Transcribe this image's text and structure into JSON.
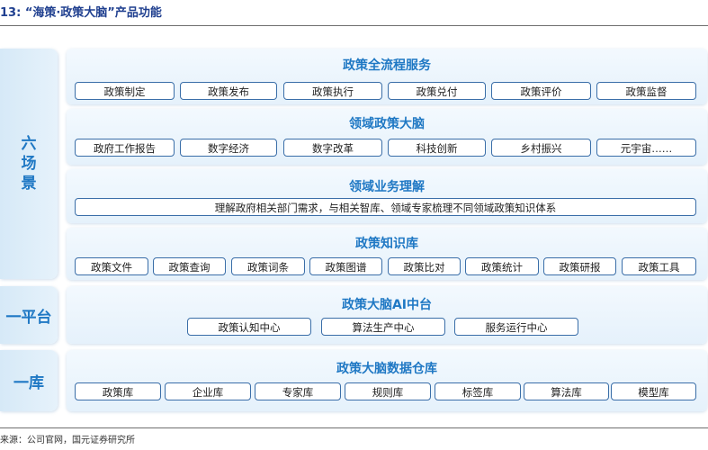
{
  "figure_title": "13: “海策·政策大脑”产品功能",
  "left_labels": {
    "scenes": [
      "六",
      "场",
      "景"
    ],
    "platform": "一平台",
    "database": "一库"
  },
  "panels": {
    "service": {
      "title": "政策全流程服务",
      "chips": [
        "政策制定",
        "政策发布",
        "政策执行",
        "政策兑付",
        "政策评价",
        "政策监督"
      ]
    },
    "domain_brain": {
      "title": "领域政策大脑",
      "chips": [
        "政府工作报告",
        "数字经济",
        "数字改革",
        "科技创新",
        "乡村振兴",
        "元宇宙……"
      ]
    },
    "business": {
      "title": "领域业务理解",
      "description": "理解政府相关部门需求，与相关智库、领域专家梳理不同领域政策知识体系"
    },
    "knowledge": {
      "title": "政策知识库",
      "chips": [
        "政策文件",
        "政策查询",
        "政策词条",
        "政策图谱",
        "政策比对",
        "政策统计",
        "政策研报",
        "政策工具"
      ]
    },
    "platform": {
      "title": "政策大脑AI中台",
      "chips": [
        "政策认知中心",
        "算法生产中心",
        "服务运行中心"
      ]
    },
    "warehouse": {
      "title": "政策大脑数据仓库",
      "chips": [
        "政策库",
        "企业库",
        "专家库",
        "规则库",
        "标签库",
        "算法库",
        "模型库"
      ]
    }
  },
  "source": "来源：公司官网，国元证券研究所",
  "colors": {
    "accent": "#1f78c4",
    "title": "#1f3f8f",
    "chip_border": "#3a6ea8",
    "panel_bg": "#e8f3fc"
  }
}
